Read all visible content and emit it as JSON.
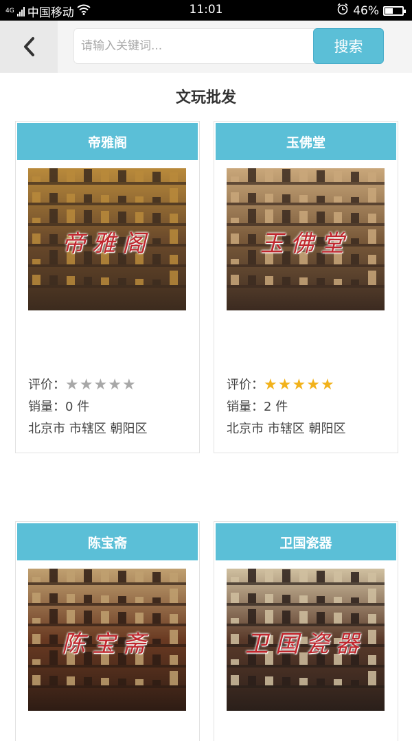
{
  "status": {
    "signal_label": "4G",
    "carrier": "中国移动",
    "time": "11:01",
    "battery": "46%",
    "battery_level": 0.46
  },
  "header": {
    "search_placeholder": "请输入关键词...",
    "search_button": "搜索"
  },
  "page_title": "文玩批发",
  "labels": {
    "rating": "评价：",
    "sales_prefix": "销量：",
    "sales_unit": "件"
  },
  "shops": [
    {
      "name": "帝雅阁",
      "rating": 0,
      "sales": "0",
      "location": "北京市 市辖区 朝阳区",
      "image_text": "帝雅阁",
      "colors": [
        "#6b4a2b",
        "#3c2b1e",
        "#b98a3b"
      ]
    },
    {
      "name": "玉佛堂",
      "rating": 5,
      "sales": "2",
      "location": "北京市 市辖区 朝阳区",
      "image_text": "玉佛堂",
      "colors": [
        "#7a5a3a",
        "#3b2a20",
        "#c9a77a"
      ]
    },
    {
      "name": "陈宝斋",
      "image_text": "陈宝斋",
      "colors": [
        "#6a3a22",
        "#2e1c14",
        "#c0a070"
      ]
    },
    {
      "name": "卫国瓷器",
      "image_text": "卫国瓷器",
      "colors": [
        "#5a3a2a",
        "#2a1f1a",
        "#d0c0a0"
      ]
    }
  ]
}
